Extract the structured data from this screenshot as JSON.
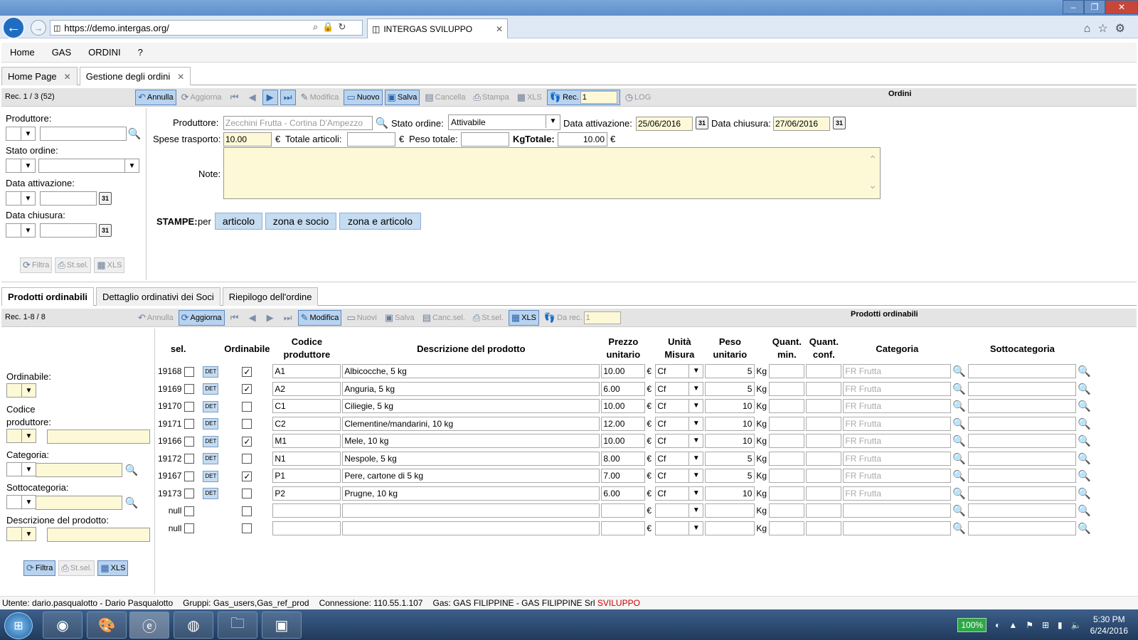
{
  "browser": {
    "url_prefix": "https://demo.",
    "url_domain": "intergas.org",
    "url_suffix": "/",
    "tab_title": "INTERGAS SVILUPPO",
    "tab_close": "✕"
  },
  "menu": [
    "Home",
    "GAS",
    "ORDINI",
    "?"
  ],
  "app_tabs": [
    {
      "label": "Home Page",
      "close": "✕"
    },
    {
      "label": "Gestione degli ordini",
      "close": "✕"
    }
  ],
  "orders_toolbar": {
    "record_info": "Rec. 1 / 3 (52)",
    "title": "Ordini",
    "annulla": "Annulla",
    "aggiorna": "Aggiorna",
    "modifica": "Modifica",
    "nuovo": "Nuovo",
    "salva": "Salva",
    "cancella": "Cancella",
    "stampa": "Stampa",
    "xls": "XLS",
    "rec_label": "Rec.",
    "rec_value": "1",
    "log": "LOG"
  },
  "order_filters": {
    "produttore": "Produttore:",
    "stato_ordine": "Stato ordine:",
    "data_attivazione": "Data attivazione:",
    "data_chiusura": "Data chiusura:",
    "filtra": "Filtra",
    "stsel": "St.sel.",
    "xls": "XLS"
  },
  "order_form": {
    "produttore_label": "Produttore:",
    "produttore_value": "Zecchini Frutta - Cortina D'Ampezzo",
    "stato_label": "Stato ordine:",
    "stato_value": "Attivabile",
    "data_att_label": "Data attivazione:",
    "data_att_value": "25/06/2016",
    "data_chiu_label": "Data chiusura:",
    "data_chiu_value": "27/06/2016",
    "spese_label": "Spese trasporto:",
    "spese_value": "10.00",
    "euro": "€",
    "totale_art_label": "Totale articoli:",
    "peso_label": "Peso totale:",
    "kg": "Kg",
    "totale_label": "Totale:",
    "totale_value": "10.00",
    "note_label": "Note:",
    "stampe_label": "STAMPE:",
    "per": "per",
    "stampe_buttons": [
      "articolo",
      "zona e socio",
      "zona e articolo"
    ]
  },
  "bottom_tabs": [
    "Prodotti ordinabili",
    "Dettaglio ordinativi dei Soci",
    "Riepilogo dell'ordine"
  ],
  "products_toolbar": {
    "record_info": "Rec. 1-8 / 8",
    "title": "Prodotti ordinabili",
    "annulla": "Annulla",
    "aggiorna": "Aggiorna",
    "modifica": "Modifica",
    "nuovi": "Nuovi",
    "salva": "Salva",
    "cancsel": "Canc.sel.",
    "stsel": "St.sel.",
    "xls": "XLS",
    "dare_label": "Da rec.",
    "dare_value": "1"
  },
  "product_filters": {
    "ordinabile": "Ordinabile:",
    "codice": "Codice produttore:",
    "categoria": "Categoria:",
    "sottocategoria": "Sottocategoria:",
    "descrizione": "Descrizione del prodotto:",
    "filtra": "Filtra",
    "stsel": "St.sel.",
    "xls": "XLS"
  },
  "product_table": {
    "headers": [
      "sel.",
      "Ordinabile",
      "Codice produttore",
      "Descrizione del prodotto",
      "Prezzo unitario",
      "Unità Misura",
      "Peso unitario",
      "Quant. min.",
      "Quant. conf.",
      "Categoria",
      "Sottocategoria"
    ],
    "det_label": "DET",
    "euro": "€",
    "kg": "Kg",
    "rows": [
      {
        "id": "19168",
        "ord": true,
        "code": "A1",
        "desc": "Albicocche, 5 kg",
        "price": "10.00",
        "um": "Cf",
        "peso": "5",
        "cat": "FR Frutta"
      },
      {
        "id": "19169",
        "ord": true,
        "code": "A2",
        "desc": "Anguria, 5 kg",
        "price": "6.00",
        "um": "Cf",
        "peso": "5",
        "cat": "FR Frutta"
      },
      {
        "id": "19170",
        "ord": false,
        "code": "C1",
        "desc": "Ciliegie, 5 kg",
        "price": "10.00",
        "um": "Cf",
        "peso": "10",
        "cat": "FR Frutta"
      },
      {
        "id": "19171",
        "ord": false,
        "code": "C2",
        "desc": "Clementine/mandarini, 10 kg",
        "price": "12.00",
        "um": "Cf",
        "peso": "10",
        "cat": "FR Frutta"
      },
      {
        "id": "19166",
        "ord": true,
        "code": "M1",
        "desc": "Mele, 10 kg",
        "price": "10.00",
        "um": "Cf",
        "peso": "10",
        "cat": "FR Frutta"
      },
      {
        "id": "19172",
        "ord": false,
        "code": "N1",
        "desc": "Nespole, 5 kg",
        "price": "8.00",
        "um": "Cf",
        "peso": "5",
        "cat": "FR Frutta"
      },
      {
        "id": "19167",
        "ord": true,
        "code": "P1",
        "desc": "Pere, cartone di 5 kg",
        "price": "7.00",
        "um": "Cf",
        "peso": "5",
        "cat": "FR Frutta"
      },
      {
        "id": "19173",
        "ord": false,
        "code": "P2",
        "desc": "Prugne, 10 kg",
        "price": "6.00",
        "um": "Cf",
        "peso": "10",
        "cat": "FR Frutta"
      },
      {
        "id": "null",
        "ord": false,
        "code": "",
        "desc": "",
        "price": "",
        "um": "",
        "peso": "",
        "cat": ""
      },
      {
        "id": "null",
        "ord": false,
        "code": "",
        "desc": "",
        "price": "",
        "um": "",
        "peso": "",
        "cat": ""
      }
    ]
  },
  "status": {
    "utente": "Utente: dario.pasqualotto - Dario Pasqualotto",
    "gruppi": "Gruppi: Gas_users,Gas_ref_prod",
    "connessione": "Connessione: 110.55.1.107",
    "gas": "Gas: GAS FILIPPINE - GAS FILIPPINE Srl",
    "env": "SVILUPPO"
  },
  "taskbar": {
    "zoom": "100%",
    "time": "5:30 PM",
    "date": "6/24/2016"
  },
  "colors": {
    "accent": "#1f6cc0",
    "button_active": "#b9d3ef",
    "field_yellow": "#fdf9d7",
    "env_red": "#cc0000"
  }
}
